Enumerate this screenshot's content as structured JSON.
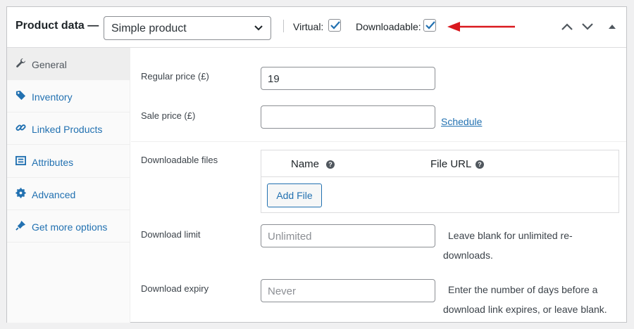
{
  "header": {
    "title": "Product data —",
    "product_type": "Simple product",
    "virtual_label": "Virtual:",
    "virtual_checked": true,
    "downloadable_label": "Downloadable:",
    "downloadable_checked": true
  },
  "sidebar": {
    "items": [
      {
        "label": "General",
        "icon": "wrench-icon",
        "active": true
      },
      {
        "label": "Inventory",
        "icon": "tag-icon"
      },
      {
        "label": "Linked Products",
        "icon": "link-icon"
      },
      {
        "label": "Attributes",
        "icon": "list-icon"
      },
      {
        "label": "Advanced",
        "icon": "gear-icon"
      },
      {
        "label": "Get more options",
        "icon": "plugin-icon"
      }
    ]
  },
  "general": {
    "regular_price_label": "Regular price (£)",
    "regular_price_value": "19",
    "sale_price_label": "Sale price (£)",
    "sale_price_value": "",
    "schedule_link": "Schedule",
    "downloadable_files_label": "Downloadable files",
    "files_table": {
      "name_header": "Name",
      "file_url_header": "File URL",
      "help_glyph": "?",
      "add_file_button": "Add File"
    },
    "download_limit_label": "Download limit",
    "download_limit_placeholder": "Unlimited",
    "download_limit_desc_1": "Leave blank for unlimited re-",
    "download_limit_desc_2": "downloads.",
    "download_expiry_label": "Download expiry",
    "download_expiry_placeholder": "Never",
    "download_expiry_desc_1": "Enter the number of days before a",
    "download_expiry_desc_2": "download link expires, or leave blank."
  },
  "colors": {
    "link": "#2271b1",
    "arrow": "#d9181e",
    "border": "#8c8f94"
  }
}
